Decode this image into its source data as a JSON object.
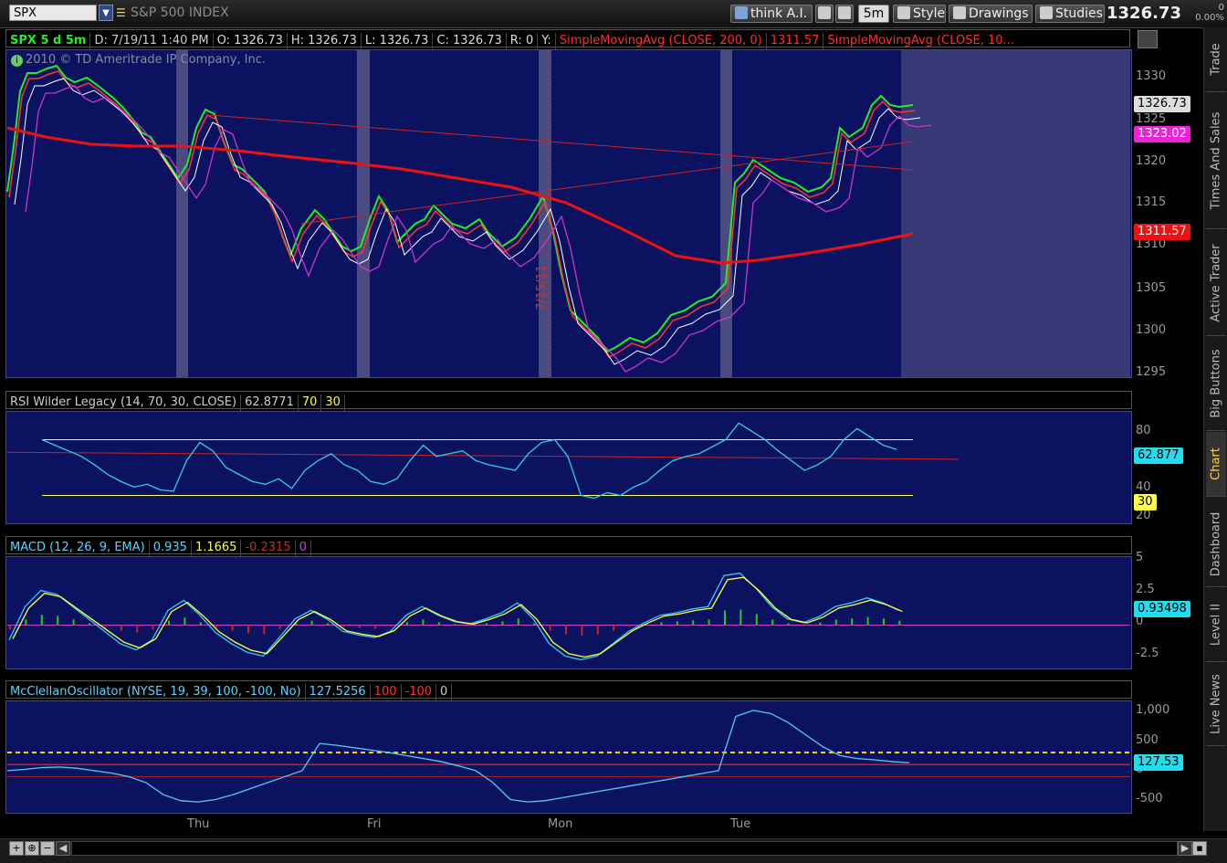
{
  "toolbar": {
    "symbol": "SPX",
    "symbol_desc": "S&P 500 INDEX",
    "think_ai": "think A.I.",
    "interval": "5m",
    "style": "Style",
    "drawings": "Drawings",
    "studies": "Studies",
    "last_price": "1326.73",
    "change": "0",
    "change_pct": "0.00%"
  },
  "chart_header": {
    "title": "SPX 5 d 5m",
    "date": "D: 7/19/11 1:40 PM",
    "open": "O: 1326.73",
    "high": "H: 1326.73",
    "low": "L: 1326.73",
    "close": "C: 1326.73",
    "range": "R: 0",
    "y": "Y:",
    "sma1": "SimpleMovingAvg (CLOSE, 200, 0)",
    "sma1_val": "1311.57",
    "sma2": "SimpleMovingAvg (CLOSE, 10..."
  },
  "copyright": "2010 © TD Ameritrade IP Company, Inc.",
  "date_marker": "7/15/11",
  "price_axis": [
    "1330",
    "1325",
    "1320",
    "1315",
    "1310",
    "1305",
    "1300",
    "1295"
  ],
  "price_tags": {
    "last": "1326.73",
    "ma": "1323.02",
    "sma200": "1311.57"
  },
  "rsi": {
    "label": "RSI Wilder Legacy (14, 70, 30, CLOSE)",
    "value": "62.8771",
    "ob": "70",
    "os": "30",
    "axis": [
      "80",
      "40",
      "20"
    ],
    "tag": "62.877",
    "tag_os": "30"
  },
  "macd": {
    "label": "MACD (12, 26, 9, EMA)",
    "value": "0.935",
    "avg": "1.1665",
    "diff": "-0.2315",
    "zero": "0",
    "axis": [
      "5",
      "2.5",
      "0",
      "-2.5"
    ],
    "tag": "0.93498"
  },
  "mcclellan": {
    "label": "McClellanOscillator (NYSE, 19, 39, 100, -100, No)",
    "value": "127.5256",
    "ob": "100",
    "os": "-100",
    "zero": "0",
    "axis": [
      "1,000",
      "500",
      "0",
      "-500"
    ],
    "tag": "127.53"
  },
  "time_axis": [
    "Thu",
    "Fri",
    "Mon",
    "Tue"
  ],
  "side_tabs": [
    "Trade",
    "Times And Sales",
    "Active Trader",
    "Big Buttons",
    "Chart",
    "Dashboard",
    "Level II",
    "Live News"
  ],
  "colors": {
    "panel_bg": "#0b1360",
    "price": "#22ee22",
    "sma200": "#ff2020",
    "rsi": "#33ccee",
    "signal": "#ffff44"
  }
}
